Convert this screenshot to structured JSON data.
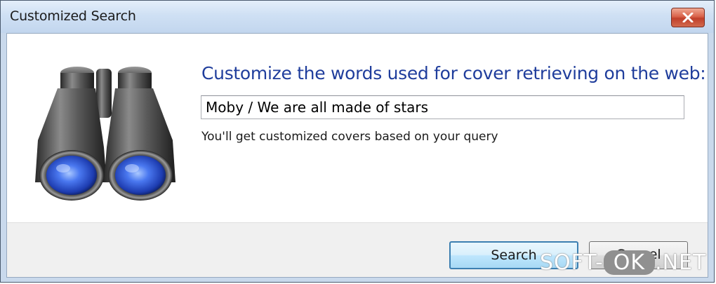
{
  "window": {
    "title": "Customized Search"
  },
  "icons": {
    "close": "close-icon",
    "illustration": "binoculars-icon"
  },
  "content": {
    "heading": "Customize the words used for cover retrieving on the web:",
    "query_value": "Moby / We are all made of stars",
    "hint": "You'll get customized covers based on your query"
  },
  "buttons": {
    "search_label": "Search",
    "cancel_label": "Cancel"
  },
  "watermark": {
    "prefix": "SOFT-",
    "highlight": "OK",
    "suffix": ".NET"
  },
  "colors": {
    "heading": "#1f3d9c",
    "close_button": "#c9442e",
    "default_button_border": "#3c7fb1"
  }
}
